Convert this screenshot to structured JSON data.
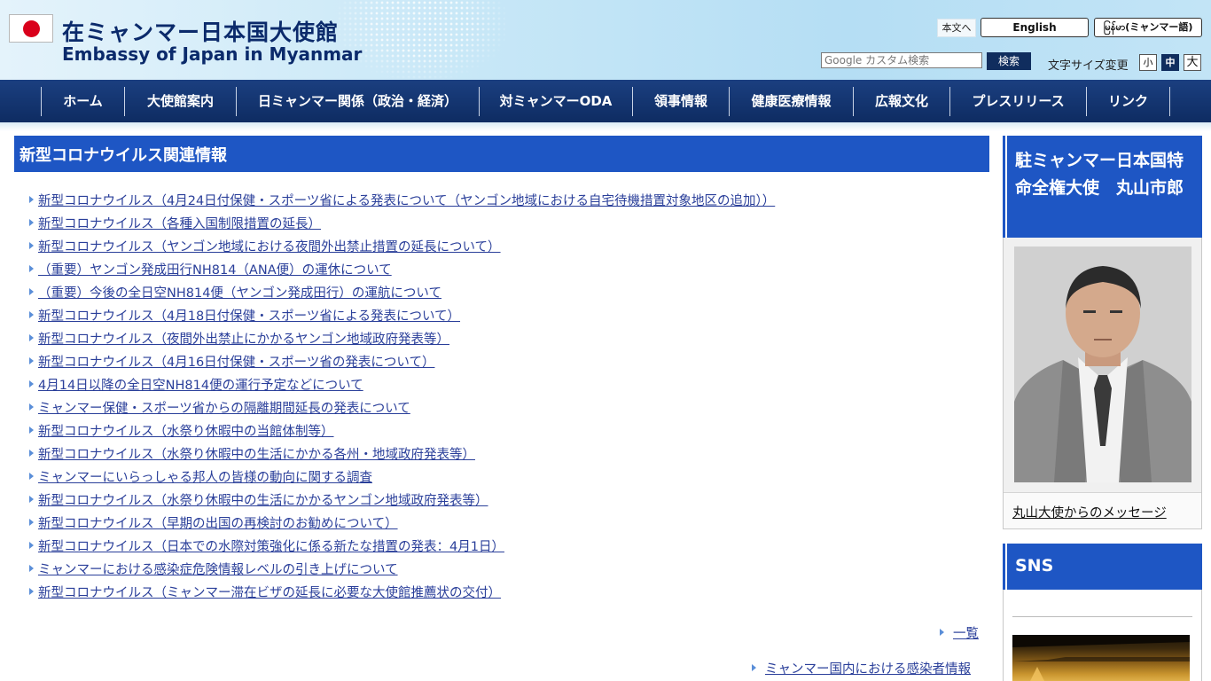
{
  "header": {
    "title_jp": "在ミャンマー日本国大使館",
    "title_en": "Embassy of Japan in Myanmar",
    "skip_link": "本文へ",
    "lang_english": "English",
    "lang_myanmar": "မြန်မာ(ミャンマー語)",
    "search_placeholder": "Google カスタム検索",
    "search_button": "検索",
    "font_size_label": "文字サイズ変更",
    "font_small": "小",
    "font_medium": "中",
    "font_large": "大"
  },
  "nav": {
    "items": [
      "ホーム",
      "大使館案内",
      "日ミャンマー関係（政治・経済）",
      "対ミャンマーODA",
      "領事情報",
      "健康医療情報",
      "広報文化",
      "プレスリリース",
      "リンク"
    ]
  },
  "main": {
    "section_title": "新型コロナウイルス関連情報",
    "news": [
      "新型コロナウイルス（4月24日付保健・スポーツ省による発表について（ヤンゴン地域における自宅待機措置対象地区の追加））",
      "新型コロナウイルス（各種入国制限措置の延長）",
      "新型コロナウイルス（ヤンゴン地域における夜間外出禁止措置の延長について）",
      "（重要）ヤンゴン発成田行NH814（ANA便）の運休について",
      "（重要）今後の全日空NH814便（ヤンゴン発成田行）の運航について",
      "新型コロナウイルス（4月18日付保健・スポーツ省による発表について）",
      "新型コロナウイルス（夜間外出禁止にかかるヤンゴン地域政府発表等）",
      "新型コロナウイルス（4月16日付保健・スポーツ省の発表について）",
      "4月14日以降の全日空NH814便の運行予定などについて",
      "ミャンマー保健・スポーツ省からの隔離期間延長の発表について",
      "新型コロナウイルス（水祭り休暇中の当館体制等）",
      "新型コロナウイルス（水祭り休暇中の生活にかかる各州・地域政府発表等）",
      "ミャンマーにいらっしゃる邦人の皆様の動向に関する調査",
      "新型コロナウイルス（水祭り休暇中の生活にかかるヤンゴン地域政府発表等）",
      "新型コロナウイルス（早期の出国の再検討のお勧めについて）",
      "新型コロナウイルス（日本での水際対策強化に係る新たな措置の発表：4月1日）",
      "ミャンマーにおける感染症危険情報レベルの引き上げについて",
      "新型コロナウイルス（ミャンマー滞在ビザの延長に必要な大使館推薦状の交付）"
    ],
    "more_link": "一覧",
    "infected_link": "ミャンマー国内における感染者情報"
  },
  "sidebar": {
    "ambassador_title": "駐ミャンマー日本国特命全権大使　丸山市郎",
    "ambassador_message": "丸山大使からのメッセージ",
    "sns_title": "SNS"
  },
  "colors": {
    "navy": "#0e2c62",
    "section_blue": "#1e56c4",
    "link": "#2a3f9a"
  }
}
